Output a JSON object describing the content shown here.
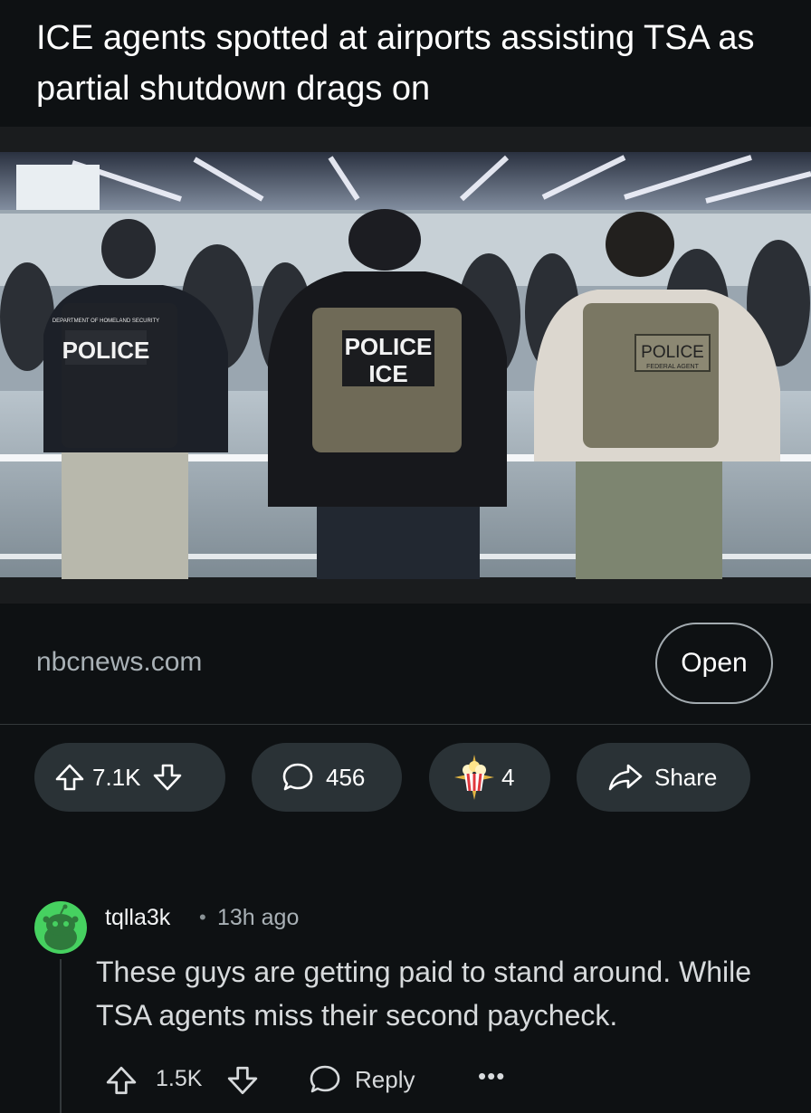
{
  "post": {
    "title": "ICE agents spotted at airports assisting TSA as partial shutdown drags on",
    "image_alt": "Officers in police vests at an airport terminal",
    "vest_labels": {
      "left_small": "DEPARTMENT OF HOMELAND SECURITY",
      "left": "POLICE",
      "center_line1": "POLICE",
      "center_line2": "ICE",
      "right": "POLICE",
      "right_small": "FEDERAL AGENT"
    },
    "link_domain": "nbcnews.com",
    "open_label": "Open"
  },
  "actions": {
    "upvote_icon": "upvote-arrow-icon",
    "vote_count": "7.1K",
    "downvote_icon": "downvote-arrow-icon",
    "comment_icon": "speech-bubble-icon",
    "comment_count": "456",
    "award_icon": "popcorn-award-icon",
    "award_count": "4",
    "share_icon": "share-arrow-icon",
    "share_label": "Share"
  },
  "comment": {
    "avatar_icon": "snoo-avatar-icon",
    "username": "tqlla3k",
    "separator": "•",
    "time": "13h ago",
    "body": "These guys are getting paid to stand around. While TSA agents miss their second paycheck.",
    "score": "1.5K",
    "reply_label": "Reply",
    "more_label": "•••"
  },
  "colors": {
    "background": "#0e1113",
    "pill": "#2a3236",
    "avatar_green": "#46d160",
    "muted_text": "#a9b1b6"
  }
}
